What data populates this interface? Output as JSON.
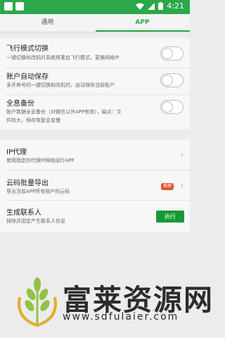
{
  "status_bar": {
    "time": "4:21"
  },
  "tabs": [
    {
      "label": "通用",
      "active": false
    },
    {
      "label": "APP",
      "active": true
    }
  ],
  "settings_toggles": [
    {
      "title": "飞行模式切换",
      "description": "一键切换和改机时系统将重启飞行模式，更换网络IP",
      "enabled": false
    },
    {
      "title": "账户自动保存",
      "description": "多开养号的一键切换和改机时，自动保存当前账户",
      "enabled": false
    },
    {
      "title": "全息备份",
      "description_lines": [
        "账户数据全息备份（对微信以外APP有效），缺点：文",
        "件较大，保存恢复会变慢"
      ],
      "enabled": false
    }
  ],
  "tools": [
    {
      "title": "IP代理",
      "description": "使用指定的代理IP网络运行APP"
    },
    {
      "title": "云码批量导出",
      "description": "导出当前APP所有账户的云码",
      "badge": "推荐"
    },
    {
      "title": "生成联系人",
      "description": "抹除并固定产生联系人信息",
      "button_label": "执行"
    }
  ],
  "watermark": {
    "brand": "富莱资源网",
    "url": "www.sdfulaier.com"
  },
  "colors": {
    "accent": "#2aa84a",
    "badge": "#e35335",
    "button": "#179936"
  }
}
